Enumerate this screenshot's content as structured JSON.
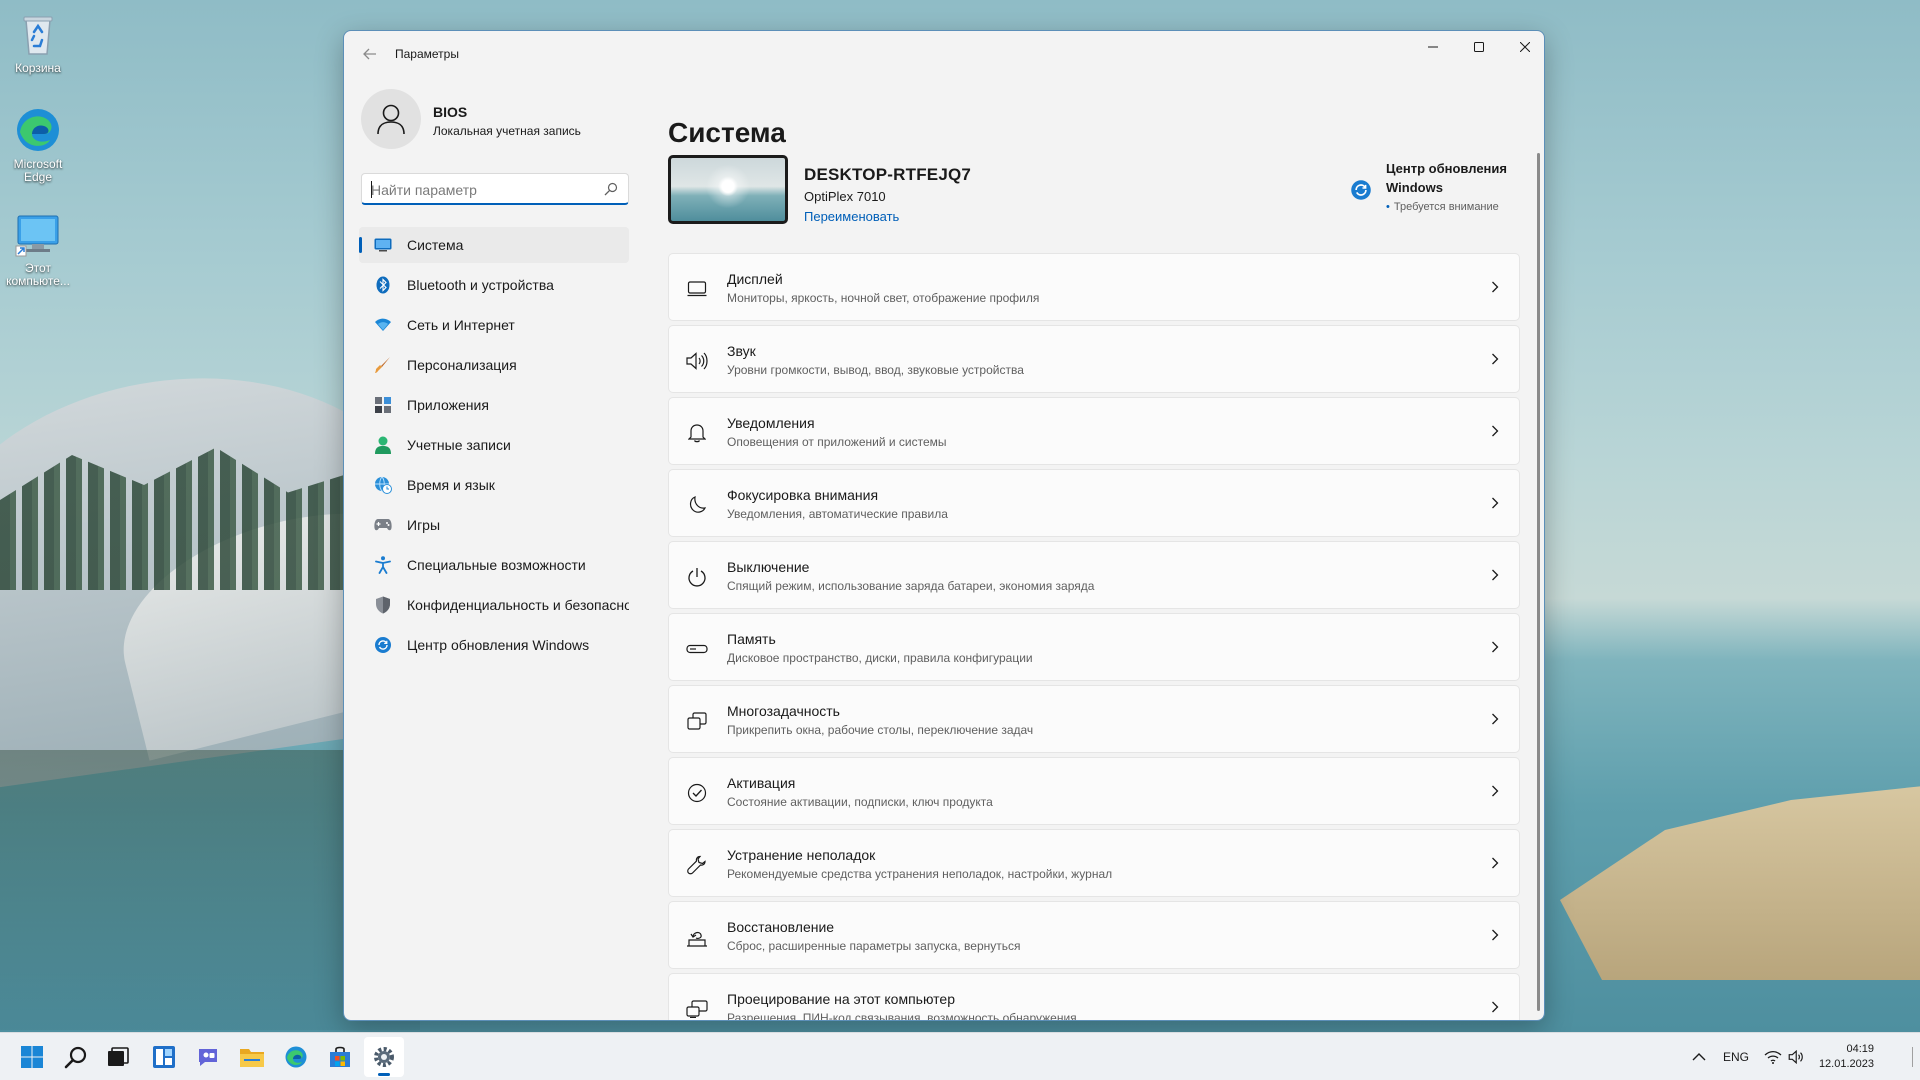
{
  "desktop": {
    "icons": [
      {
        "label": "Корзина",
        "icon": "recycle-bin-icon"
      },
      {
        "label": "Microsoft Edge",
        "icon": "edge-icon"
      },
      {
        "label": "Этот компьюте...",
        "icon": "this-pc-icon"
      }
    ]
  },
  "window": {
    "title": "Параметры",
    "controls": {
      "minimize": "minimize-icon",
      "maximize": "maximize-icon",
      "close": "close-icon"
    }
  },
  "profile": {
    "name": "BIOS",
    "account_type": "Локальная учетная запись"
  },
  "search": {
    "placeholder": "Найти параметр",
    "value": ""
  },
  "sidebar": {
    "items": [
      {
        "label": "Система",
        "icon": "system-icon",
        "active": true
      },
      {
        "label": "Bluetooth и устройства",
        "icon": "bluetooth-icon"
      },
      {
        "label": "Сеть и Интернет",
        "icon": "wifi-icon"
      },
      {
        "label": "Персонализация",
        "icon": "brush-icon"
      },
      {
        "label": "Приложения",
        "icon": "apps-icon"
      },
      {
        "label": "Учетные записи",
        "icon": "accounts-icon"
      },
      {
        "label": "Время и язык",
        "icon": "globe-clock-icon"
      },
      {
        "label": "Игры",
        "icon": "gamepad-icon"
      },
      {
        "label": "Специальные возможности",
        "icon": "accessibility-icon"
      },
      {
        "label": "Конфиденциальность и безопасность",
        "icon": "shield-icon"
      },
      {
        "label": "Центр обновления Windows",
        "icon": "update-icon"
      }
    ]
  },
  "main": {
    "title": "Система",
    "device": {
      "name": "DESKTOP-RTFEJQ7",
      "model": "OptiPlex 7010",
      "rename_link": "Переименовать"
    },
    "update": {
      "title": "Центр обновления Windows",
      "status": "Требуется внимание"
    },
    "cards": [
      {
        "title": "Дисплей",
        "subtitle": "Мониторы, яркость, ночной свет, отображение профиля",
        "icon": "display-icon"
      },
      {
        "title": "Звук",
        "subtitle": "Уровни громкости, вывод, ввод, звуковые устройства",
        "icon": "speaker-icon"
      },
      {
        "title": "Уведомления",
        "subtitle": "Оповещения от приложений и системы",
        "icon": "bell-icon"
      },
      {
        "title": "Фокусировка внимания",
        "subtitle": "Уведомления, автоматические правила",
        "icon": "moon-icon"
      },
      {
        "title": "Выключение",
        "subtitle": "Спящий режим, использование заряда батареи, экономия заряда",
        "icon": "power-icon"
      },
      {
        "title": "Память",
        "subtitle": "Дисковое пространство, диски, правила конфигурации",
        "icon": "storage-icon"
      },
      {
        "title": "Многозадачность",
        "subtitle": "Прикрепить окна, рабочие столы, переключение задач",
        "icon": "multitasking-icon"
      },
      {
        "title": "Активация",
        "subtitle": "Состояние активации, подписки, ключ продукта",
        "icon": "check-circle-icon"
      },
      {
        "title": "Устранение неполадок",
        "subtitle": "Рекомендуемые средства устранения неполадок, настройки, журнал",
        "icon": "wrench-icon"
      },
      {
        "title": "Восстановление",
        "subtitle": "Сброс, расширенные параметры запуска, вернуться",
        "icon": "recovery-icon"
      },
      {
        "title": "Проецирование на этот компьютер",
        "subtitle": "Разрешения, ПИН-код связывания, возможность обнаружения",
        "icon": "projection-icon"
      }
    ]
  },
  "taskbar": {
    "apps": [
      "start-icon",
      "search-icon",
      "task-view-icon",
      "widgets-icon",
      "chat-icon",
      "file-explorer-icon",
      "edge-icon",
      "store-icon",
      "settings-icon"
    ],
    "tray": {
      "language": "ENG",
      "time": "04:19",
      "date": "12.01.2023"
    }
  },
  "colors": {
    "accent": "#005fb8",
    "window_bg": "#f3f3f3",
    "card_bg": "#fbfbfb",
    "taskbar_bg": "#eef1f4"
  }
}
